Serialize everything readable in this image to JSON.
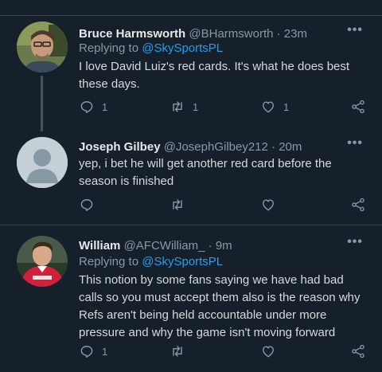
{
  "tweets": [
    {
      "name": "Bruce Harmsworth",
      "handle": "@BHarmsworth",
      "time": "23m",
      "reply_prefix": "Replying to ",
      "reply_to": "@SkySportsPL",
      "text_lines": [
        "I love David Luiz's red cards.  It's what he does best",
        "these days."
      ],
      "reply_count": "1",
      "retweet_count": "1",
      "like_count": "1"
    },
    {
      "name": "Joseph Gilbey",
      "handle": "@JosephGilbey212",
      "time": "20m",
      "text_lines": [
        "yep, i bet he will get another red card before the",
        "season is finished"
      ],
      "reply_count": "",
      "retweet_count": "",
      "like_count": ""
    },
    {
      "name": "William",
      "handle": "@AFCWilliam_",
      "time": "9m",
      "reply_prefix": "Replying to ",
      "reply_to": "@SkySportsPL",
      "text_lines": [
        "This notion by some fans saying we have had bad",
        "calls so you must accept them also is the reason why",
        "Refs aren't being held accountable under more",
        "pressure and why the game isn't moving forward"
      ],
      "reply_count": "1",
      "retweet_count": "",
      "like_count": ""
    }
  ],
  "separator": "·",
  "more_glyph": "•••",
  "icons": {
    "reply": "reply-icon",
    "retweet": "retweet-icon",
    "like": "heart-icon",
    "share": "share-icon"
  },
  "colors": {
    "background": "#15202b",
    "accent": "#1da1f2",
    "muted": "#8899a6",
    "divider": "#38444d"
  }
}
